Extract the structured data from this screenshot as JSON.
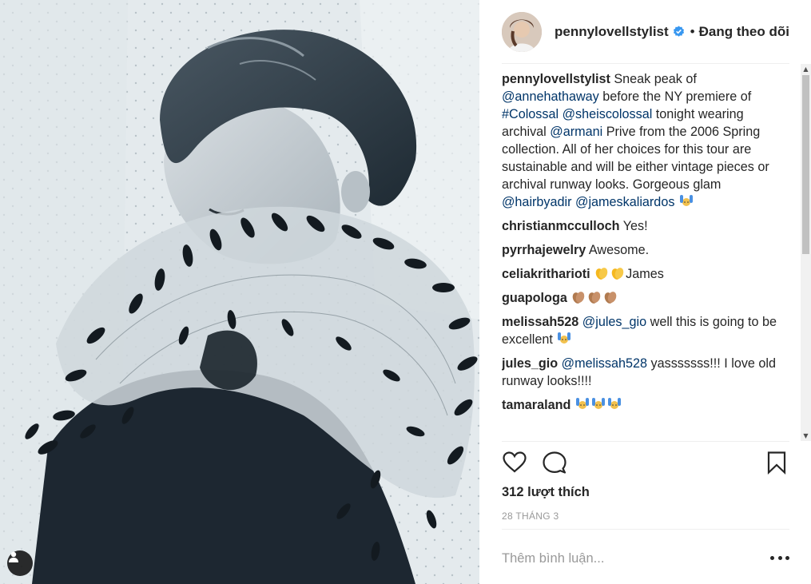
{
  "photo": {
    "alt_icon": "user-tag-icon"
  },
  "header": {
    "username": "pennylovellstylist",
    "verified_icon": "verified-badge-icon",
    "separator": "•",
    "follow_label": "Đang theo dõi"
  },
  "caption": {
    "username": "pennylovellstylist",
    "t1": " Sneak peak of ",
    "m1": "@annehathaway",
    "t2": " before the NY premiere of ",
    "h1": "#Colossal",
    "t3": " ",
    "m2": "@sheiscolossal",
    "t4": " tonight wearing archival ",
    "m3": "@armani",
    "t5": " Prive from the 2006 Spring collection. All of her choices for this tour are sustainable and will be either vintage pieces or archival runway looks. Gorgeous glam ",
    "m4": "@hairbyadir",
    "t6": " ",
    "m5": "@jameskaliardos",
    "t7": " "
  },
  "comments": [
    {
      "user": "christianmcculloch",
      "text": " Yes!"
    },
    {
      "user": "pyrrhajewelry",
      "text": " Awesome."
    },
    {
      "user": "celiakritharioti",
      "text": "James"
    },
    {
      "user": "guapologa",
      "text": ""
    },
    {
      "user": "melissah528",
      "mention": "@jules_gio",
      "text": " well this is going to be excellent "
    },
    {
      "user": "jules_gio",
      "mention": "@melissah528",
      "text": " yasssssss!!! I love old runway looks!!!!"
    },
    {
      "user": "tamaraland",
      "text": ""
    }
  ],
  "actions": {
    "like_icon": "heart-icon",
    "comment_icon": "comment-icon",
    "save_icon": "bookmark-icon"
  },
  "likes": "312 lượt thích",
  "date": "28 THÁNG 3",
  "add_comment": {
    "placeholder": "Thêm bình luận..."
  },
  "more_icon": "more-options-icon",
  "colors": {
    "link": "#003569",
    "text": "#262626",
    "muted": "#999999",
    "verified": "#3897f0",
    "border": "#efefef"
  }
}
